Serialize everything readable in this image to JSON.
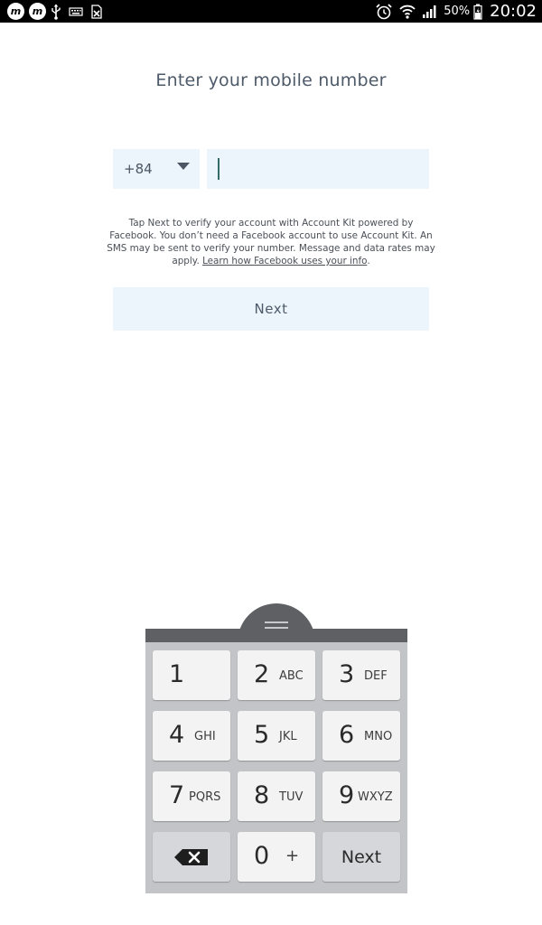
{
  "status_bar": {
    "app_icon_1": "m",
    "app_icon_2": "m",
    "icons": [
      "messenger-icon",
      "messenger-icon",
      "usb-icon",
      "keyboard-icon",
      "download-icon",
      "alarm-icon",
      "wifi-icon",
      "signal-icon",
      "battery-icon"
    ],
    "battery": "50%",
    "time": "20:02"
  },
  "screen": {
    "title": "Enter your mobile number",
    "country_code": "+84",
    "phone_value": "",
    "disclaimer_text": "Tap Next to verify your account with Account Kit powered by Facebook. You don’t need a Facebook account to use Account Kit. An SMS may be sent to verify your number. Message and data rates may apply.",
    "disclaimer_link": "Learn how Facebook uses your info",
    "disclaimer_end": ".",
    "next_label": "Next"
  },
  "keypad": {
    "keys": [
      {
        "digit": "1",
        "letters": ""
      },
      {
        "digit": "2",
        "letters": "ABC"
      },
      {
        "digit": "3",
        "letters": "DEF"
      },
      {
        "digit": "4",
        "letters": "GHI"
      },
      {
        "digit": "5",
        "letters": "JKL"
      },
      {
        "digit": "6",
        "letters": "MNO"
      },
      {
        "digit": "7",
        "letters": "PQRS"
      },
      {
        "digit": "8",
        "letters": "TUV"
      },
      {
        "digit": "9",
        "letters": "WXYZ"
      }
    ],
    "zero": {
      "digit": "0",
      "extra": "+"
    },
    "backspace_icon": "backspace-icon",
    "next_label": "Next"
  },
  "colors": {
    "accent_field": "#edf5fc",
    "title_text": "#4d5a69",
    "cursor": "#336b68",
    "keypad_bg": "#c3c4c7",
    "keypad_bar": "#5f6064"
  }
}
